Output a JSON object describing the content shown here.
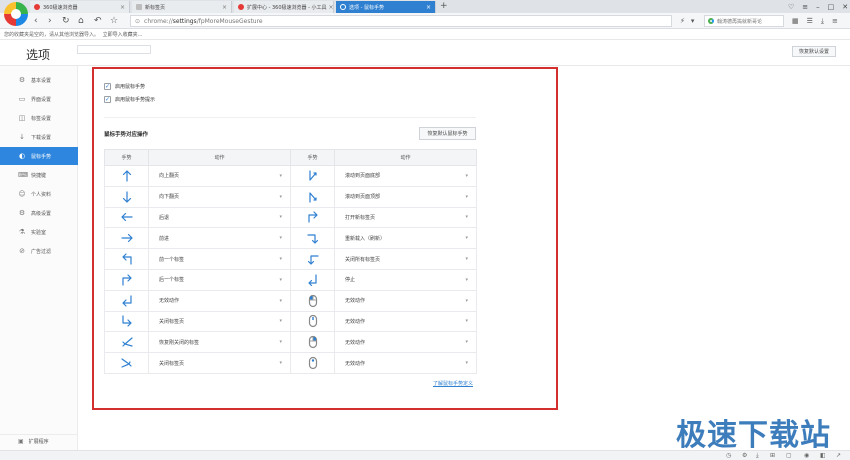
{
  "tabs": [
    {
      "label": "360极速浏览器",
      "icon": "browser-logo-icon",
      "color": "#e53935",
      "active": false
    },
    {
      "label": "新标签页",
      "icon": "page-icon",
      "color": "#9e9e9e",
      "active": false
    },
    {
      "label": "扩展中心 - 360极速浏览器 - 小工具",
      "icon": "extension-center-icon",
      "color": "#e53935",
      "active": false
    },
    {
      "label": "选项 - 鼠标手势",
      "icon": "gear-icon",
      "color": "#ffffff",
      "active": true
    }
  ],
  "address": {
    "scheme": "chrome://",
    "host": "settings",
    "path": "/fpMoreMouseGesture"
  },
  "search": {
    "placeholder": "翰涛德再捣就新哥论"
  },
  "favorites_bar": {
    "text": "您的收藏夹是空的，请从其他浏览器导入。",
    "link": "立即导入收藏夹..."
  },
  "page": {
    "title": "选项",
    "reset_all": "恢复默认设置"
  },
  "sidebar": {
    "items": [
      {
        "label": "基本设置",
        "icon": "gear-icon",
        "active": false
      },
      {
        "label": "界面设置",
        "icon": "layout-icon",
        "active": false
      },
      {
        "label": "标签设置",
        "icon": "tag-icon",
        "active": false
      },
      {
        "label": "下载设置",
        "icon": "download-icon",
        "active": false
      },
      {
        "label": "鼠标手势",
        "icon": "mouse-gesture-icon",
        "active": true
      },
      {
        "label": "快捷键",
        "icon": "keyboard-icon",
        "active": false
      },
      {
        "label": "个人资料",
        "icon": "user-icon",
        "active": false
      },
      {
        "label": "高级设置",
        "icon": "advanced-icon",
        "active": false
      },
      {
        "label": "实验室",
        "icon": "lab-icon",
        "active": false
      },
      {
        "label": "广告过滤",
        "icon": "ad-block-icon",
        "active": false
      }
    ],
    "footer": {
      "label": "扩展程序",
      "icon": "extension-icon"
    }
  },
  "gesture_settings": {
    "enable_gesture": "启用鼠标手势",
    "enable_gesture_checked": true,
    "show_hint": "启用鼠标手势提示",
    "show_hint_checked": true,
    "section_title": "鼠标手势对应操作",
    "reset_button": "恢复默认鼠标手势",
    "columns": [
      "手势",
      "动作",
      "手势",
      "动作"
    ],
    "rows": [
      {
        "left_gesture": "up-arrow-icon",
        "left_action": "向上翻页",
        "right_gesture": "down-up-icon",
        "right_action": "滚动到页面底部"
      },
      {
        "left_gesture": "down-arrow-icon",
        "left_action": "向下翻页",
        "right_gesture": "up-down-icon",
        "right_action": "滚动到页面顶部"
      },
      {
        "left_gesture": "left-arrow-icon",
        "left_action": "后退",
        "right_gesture": "up-right-icon",
        "right_action": "打开新标签页"
      },
      {
        "left_gesture": "right-arrow-icon",
        "left_action": "前进",
        "right_gesture": "right-down-icon",
        "right_action": "重新载入（刷新）"
      },
      {
        "left_gesture": "up-left-icon",
        "left_action": "前一个标签",
        "right_gesture": "left-down-icon",
        "right_action": "关闭所有标签页"
      },
      {
        "left_gesture": "up-right-icon",
        "left_action": "后一个标签",
        "right_gesture": "down-left-icon",
        "right_action": "停止"
      },
      {
        "left_gesture": "down-left-corner-icon",
        "left_action": "无效动作",
        "right_gesture": "mouse-left-icon",
        "right_action": "无效动作"
      },
      {
        "left_gesture": "down-right-corner-icon",
        "left_action": "关闭标签页",
        "right_gesture": "mouse-middle-icon",
        "right_action": "无效动作"
      },
      {
        "left_gesture": "up-left-diagonal-icon",
        "left_action": "恢复刚关闭的标签",
        "right_gesture": "mouse-right-icon",
        "right_action": "无效动作"
      },
      {
        "left_gesture": "down-right-diagonal-icon",
        "left_action": "关闭标签页",
        "right_gesture": "mouse-wheel-icon",
        "right_action": "无效动作"
      }
    ],
    "learn_more": "了解鼠标手势定义"
  },
  "watermark": "极速下载站",
  "colors": {
    "accent": "#2f80d1",
    "highlight_frame": "#d32f2f",
    "sidebar_active": "#2f86de"
  }
}
